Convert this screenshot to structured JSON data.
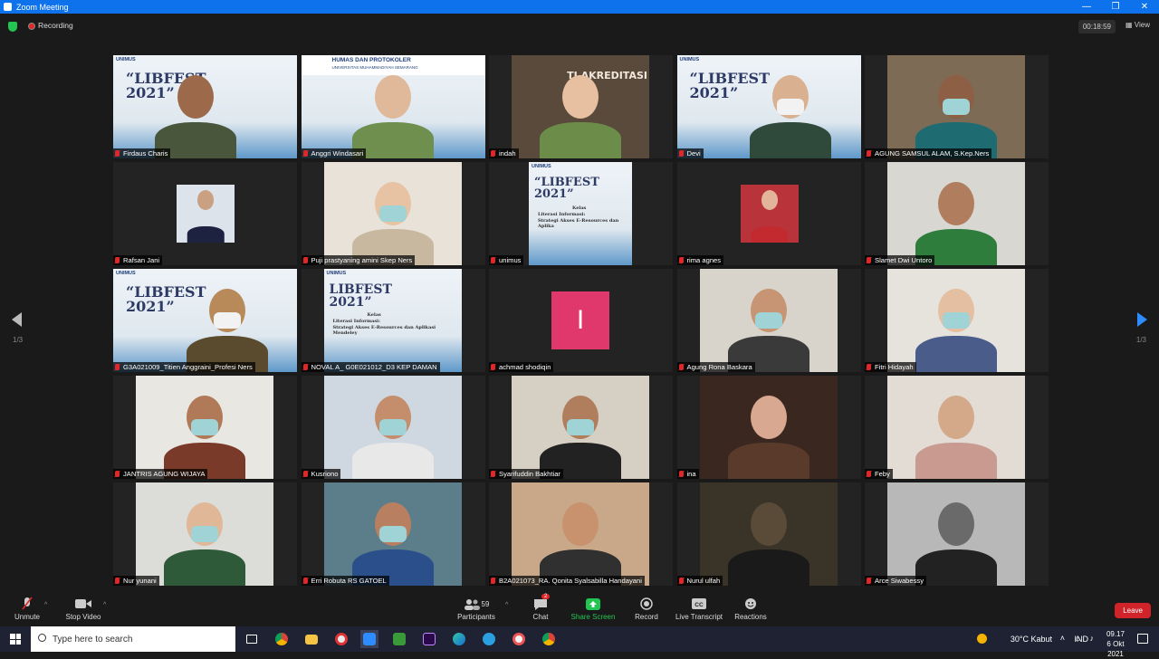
{
  "window": {
    "title": "Zoom Meeting",
    "controls": [
      "—",
      "❐",
      "✕"
    ]
  },
  "header": {
    "recording_label": "Recording",
    "timer": "00:18:59",
    "view_label": "View"
  },
  "navigation": {
    "page_indicator_left": "1/3",
    "page_indicator_right": "1/3"
  },
  "participants": [
    {
      "name": "Firdaus Charis",
      "type": "slide-person",
      "skin": "#9c6a4a",
      "shirt": "#49563b"
    },
    {
      "name": "Anggri Windasari",
      "type": "banner",
      "banner_text": "HUMAS DAN PROTOKOLER",
      "banner_sub": "UNIVERSITAS MUHAMMADIYAH SEMARANG",
      "skin": "#e0b89a",
      "shirt": "#6e8f4e"
    },
    {
      "name": "indah",
      "type": "person",
      "bg": "#5a4a3c",
      "skin": "#e6c0a0",
      "shirt": "#6c8c4a",
      "banner_text": "TI AKREDITASI"
    },
    {
      "name": "Devi",
      "type": "slide-mask",
      "skin": "#d9b090",
      "shirt": "#2f4a3a",
      "active": true
    },
    {
      "name": "AGUNG SAMSUL ALAM, S.Kep.Ners",
      "type": "person",
      "bg": "#7d6b55",
      "skin": "#8d5f45",
      "shirt": "#1f6b72",
      "mask": true
    },
    {
      "name": "Rafsan Jani",
      "type": "small-photo",
      "photo_bg": "#dde3ea",
      "skin": "#caa083",
      "shirt": "#1c2240"
    },
    {
      "name": "Puji prastyaning amini Skep Ners",
      "type": "person",
      "bg": "#e8e2d8",
      "skin": "#e7c3a4",
      "shirt": "#c8b8a0",
      "mask": true
    },
    {
      "name": "unimus",
      "type": "slide-only",
      "slide_title": "“LIBFEST 2021”",
      "slide_lines": [
        "Kelas",
        "Literasi Informasi:",
        "Strategi Akses E-Resources dan Aplika"
      ]
    },
    {
      "name": "rima agnes",
      "type": "small-photo",
      "photo_bg": "#b8343a",
      "skin": "#e2b59a",
      "shirt": "#c22a30"
    },
    {
      "name": "Slamet Dwi Untoro",
      "type": "person",
      "bg": "#d9d7d2",
      "skin": "#b07e5e",
      "shirt": "#2e7d3d"
    },
    {
      "name": "G3A021009_Titien Anggraini_Profesi Ners",
      "type": "slide-mask",
      "skin": "#b88a5a",
      "shirt": "#5a4a2e"
    },
    {
      "name": "NOVAL A_ G0E021012_D3 KEP DAMAN",
      "type": "slide-only",
      "slide_title": "LIBFEST 2021”",
      "slide_lines": [
        "Kelas",
        "Literasi Informasi:",
        "Strategi Akses E-Resources dan Aplikasi Mendeley"
      ]
    },
    {
      "name": "achmad shodiqin",
      "type": "avatar",
      "initial": "I",
      "avatar_color": "#e0386c"
    },
    {
      "name": "Agung Rona Baskara",
      "type": "person",
      "bg": "#d8d4cc",
      "skin": "#c89574",
      "shirt": "#3a3a3a",
      "mask": true
    },
    {
      "name": "Fitri Hidayah",
      "type": "person",
      "bg": "#e6e2dc",
      "skin": "#e4bfa2",
      "shirt": "#4a5d8a",
      "mask": true
    },
    {
      "name": "JANTRIS AGUNG WIJAYA",
      "type": "person",
      "bg": "#e9e7e2",
      "skin": "#b07a58",
      "shirt": "#7a3a2a",
      "mask": true
    },
    {
      "name": "Kusriono",
      "type": "person",
      "bg": "#cfd8e0",
      "skin": "#c48e6c",
      "shirt": "#e8e8e8",
      "mask": true
    },
    {
      "name": "Syarifuddin Bakhtiar",
      "type": "person",
      "bg": "#d6cfc4",
      "skin": "#b07e5c",
      "shirt": "#222",
      "mask": true
    },
    {
      "name": "ina",
      "type": "person",
      "bg": "#3a2820",
      "skin": "#d8a890",
      "shirt": "#5a3a2a"
    },
    {
      "name": "Feby",
      "type": "person",
      "bg": "#e2dcd4",
      "skin": "#d4a98a",
      "shirt": "#c89a90"
    },
    {
      "name": "Nur yunani",
      "type": "person",
      "bg": "#dcdcd8",
      "skin": "#e0b898",
      "shirt": "#2f5a3a",
      "mask": true
    },
    {
      "name": "Erri Robuta RS GATOEL",
      "type": "person",
      "bg": "#5b7e8a",
      "skin": "#b88060",
      "shirt": "#2a4f8a",
      "mask": true
    },
    {
      "name": "B2A021073_RA. Qonita Syalsabilla Handayani",
      "type": "person",
      "bg": "#c9a88a",
      "skin": "#c8926e",
      "shirt": "#303030"
    },
    {
      "name": "Nurul ulfah",
      "type": "person",
      "bg": "#3a3428",
      "skin": "#5a4a38",
      "shirt": "#1a1a1a"
    },
    {
      "name": "Arce Siwabessy",
      "type": "person",
      "bg": "#b8b8b8",
      "skin": "#6a6a6a",
      "shirt": "#222"
    }
  ],
  "toolbar": {
    "unmute": "Unmute",
    "stop_video": "Stop Video",
    "participants": "Participants",
    "participants_count": "59",
    "chat": "Chat",
    "chat_badge": "2",
    "share_screen": "Share Screen",
    "record": "Record",
    "live_transcript": "Live Transcript",
    "reactions": "Reactions",
    "leave": "Leave"
  },
  "taskbar": {
    "search_placeholder": "Type here to search",
    "weather": "30°C  Kabut",
    "language": "IND",
    "time": "09.17",
    "date": "6 Okt 2021"
  },
  "colors": {
    "zoom_blue": "#0e72ed",
    "active_speaker": "#f2e94e",
    "leave": "#d1232a",
    "share_green": "#23c552"
  }
}
